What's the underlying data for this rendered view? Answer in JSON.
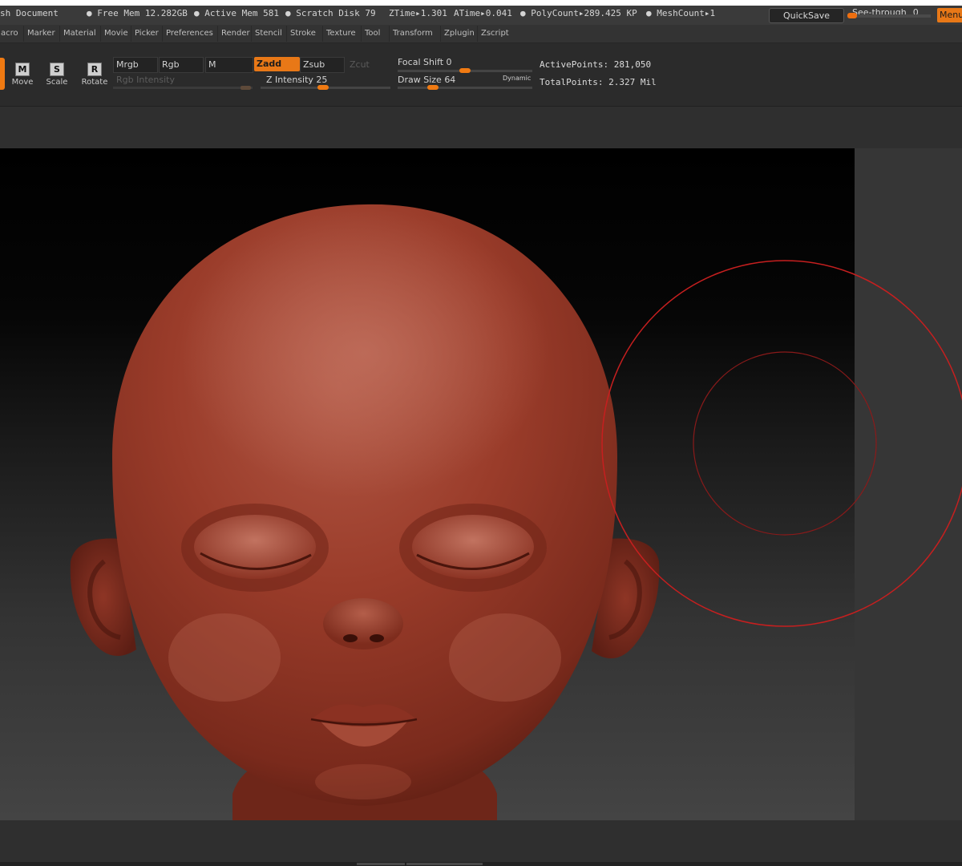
{
  "title_bar": {
    "document": "sh Document",
    "free_mem": "Free Mem 12.282GB",
    "active_mem": "Active Mem 581",
    "scratch_disk": "Scratch Disk 79",
    "ztime": "ZTime▸1.301",
    "atime": "ATime▸0.041",
    "polycount": "PolyCount▸289.425 KP",
    "meshcount": "MeshCount▸1",
    "quicksave": "QuickSave",
    "see_through_label": "See-through",
    "see_through_value": "0",
    "menus_label": "Menus"
  },
  "menubar": {
    "items": [
      "acro",
      "Marker",
      "Material",
      "Movie",
      "Picker",
      "Preferences",
      "Render",
      "Stencil",
      "Stroke",
      "Texture",
      "Tool",
      "Transform",
      "Zplugin",
      "Zscript"
    ]
  },
  "toolbar": {
    "move": "Move",
    "move_key": "M",
    "scale": "Scale",
    "scale_key": "S",
    "rotate": "Rotate",
    "rotate_key": "R",
    "mrgb": "Mrgb",
    "rgb": "Rgb",
    "m": "M",
    "zadd": "Zadd",
    "zsub": "Zsub",
    "zcut": "Zcut",
    "rgb_intensity": "Rgb Intensity",
    "z_intensity_label": "Z Intensity",
    "z_intensity_value": "25",
    "focal_shift_label": "Focal Shift",
    "focal_shift_value": "0",
    "draw_size_label": "Draw Size",
    "draw_size_value": "64",
    "dynamic": "Dynamic",
    "active_points": "ActivePoints: 281,050",
    "total_points": "TotalPoints: 2.327 Mil"
  },
  "colors": {
    "accent": "#e87817",
    "clay": "#9b3a28",
    "brush_ring": "#c61f1f"
  }
}
